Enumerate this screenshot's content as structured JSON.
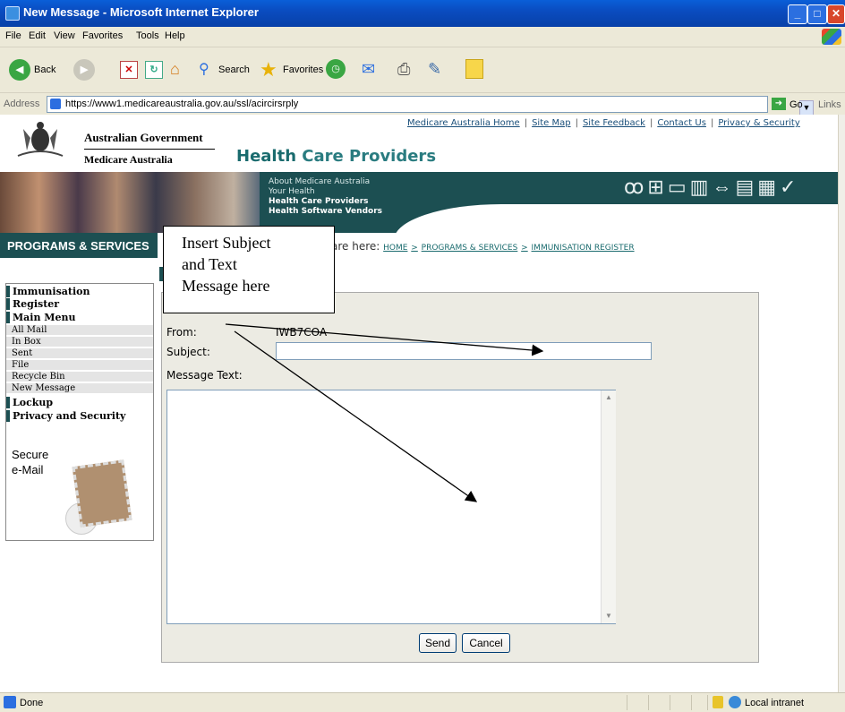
{
  "window": {
    "title": "New Message - Microsoft Internet Explorer"
  },
  "menu": [
    "File",
    "Edit",
    "View",
    "Favorites",
    "Tools",
    "Help"
  ],
  "toolbar": {
    "back_label": "Back",
    "search_label": "Search",
    "favorites_label": "Favorites"
  },
  "address": {
    "label": "Address",
    "url": "https://www1.medicareaustralia.gov.au/ssl/acircirsrply",
    "go_label": "Go",
    "links_label": "Links"
  },
  "header": {
    "gov_name": "Australian Government",
    "org_name": "Medicare Australia",
    "top_links": [
      "Medicare Australia Home",
      "Site Map",
      "Site Feedback",
      "Contact Us",
      "Privacy & Security"
    ],
    "section_title_highlight": "Health",
    "section_title_rest": "Care Providers"
  },
  "banner": {
    "nav": [
      "About Medicare Australia",
      "Your Health",
      "Health Care Providers",
      "Health Software Vendors"
    ]
  },
  "programs": {
    "label": "PROGRAMS & SERVICES",
    "breadcrumb_prefix": "are here:",
    "breadcrumb_home": "HOME",
    "breadcrumb_programs": "PROGRAMS & SERVICES",
    "breadcrumb_current": "IMMUNISATION REGISTER"
  },
  "sidebar": {
    "heading1": "Immunisation",
    "heading1b": "Register",
    "heading2": "Main Menu",
    "items": [
      "All Mail",
      "In Box",
      "Sent",
      "File",
      "Recycle Bin",
      "New Message"
    ],
    "heading3": "Lockup",
    "heading4": "Privacy and Security",
    "secure_line1": "Secure",
    "secure_line2": "e-Mail"
  },
  "form": {
    "from_label": "From:",
    "from_value": "IWB7COA",
    "subject_label": "Subject:",
    "subject_value": "",
    "message_label": "Message Text:",
    "message_value": "",
    "send_label": "Send",
    "cancel_label": "Cancel"
  },
  "callout": {
    "line1": "Insert Subject",
    "line2": "and Text",
    "line3": "Message here"
  },
  "status": {
    "left": "Done",
    "zone": "Local intranet"
  }
}
